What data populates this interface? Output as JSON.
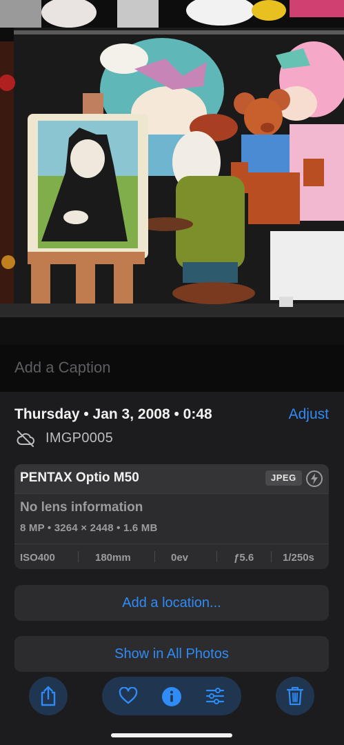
{
  "photo": {
    "description_icon": "photo-image"
  },
  "caption": {
    "placeholder": "Add a Caption"
  },
  "info": {
    "datetime": "Thursday • Jan 3, 2008 • 0:48",
    "adjust_label": "Adjust",
    "cloud_icon": "cloud-slash-icon",
    "filename": "IMGP0005"
  },
  "camera_card": {
    "camera": "PENTAX Optio M50",
    "format_badge": "JPEG",
    "flash_icon": "flash-icon",
    "lens": "No lens information",
    "specs": "8 MP • 3264 × 2448 • 1.6 MB",
    "exif": {
      "iso": "ISO400",
      "focal": "180mm",
      "ev": "0ev",
      "aperture": "ƒ5.6",
      "shutter": "1/250s"
    }
  },
  "buttons": {
    "add_location": "Add a location...",
    "show_all": "Show in All Photos"
  },
  "toolbar": {
    "share_icon": "share-icon",
    "favorite_icon": "heart-icon",
    "info_icon": "info-icon",
    "adjust_icon": "sliders-icon",
    "delete_icon": "trash-icon"
  },
  "colors": {
    "accent": "#2f8cf6",
    "background": "#1c1c1e",
    "card": "#2c2c2e",
    "toolbar_button": "#1f3550"
  }
}
